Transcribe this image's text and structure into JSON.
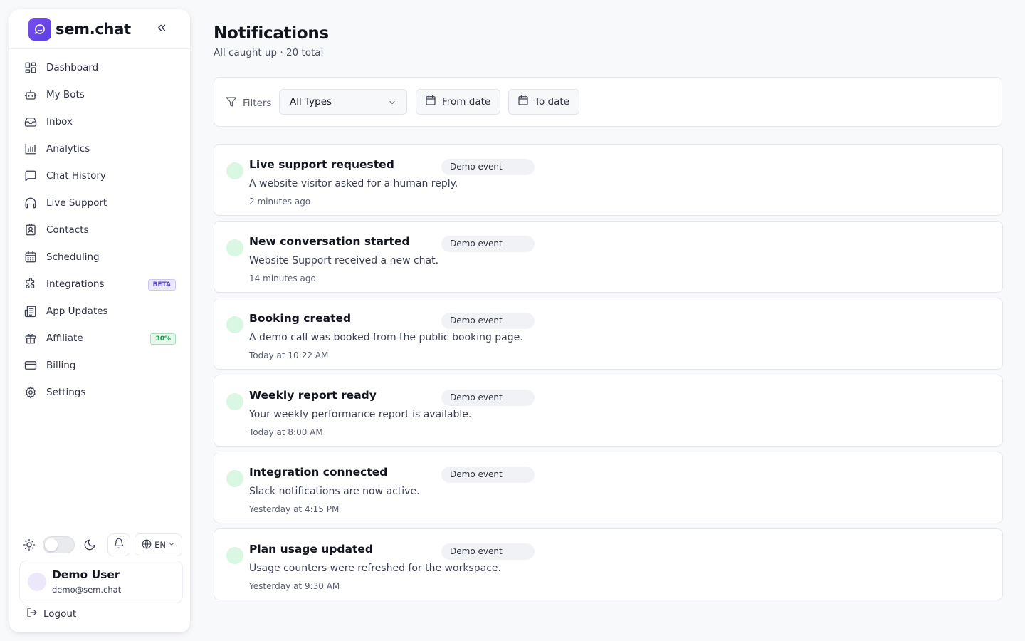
{
  "sidebar": {
    "brand": {
      "name": "sem.chat",
      "logo_icon": "chat-bubble-icon",
      "accent": "#6a45ec"
    },
    "items": [
      {
        "label": "Dashboard",
        "icon": "dashboard-icon"
      },
      {
        "label": "My Bots",
        "icon": "bot-icon"
      },
      {
        "label": "Inbox",
        "icon": "inbox-icon"
      },
      {
        "label": "Analytics",
        "icon": "bar-chart-icon"
      },
      {
        "label": "Chat History",
        "icon": "chat-icon"
      },
      {
        "label": "Live Support",
        "icon": "headphones-icon"
      },
      {
        "label": "Contacts",
        "icon": "contact-card-icon"
      },
      {
        "label": "Scheduling",
        "icon": "calendar-icon"
      },
      {
        "label": "Integrations",
        "icon": "puzzle-icon",
        "badge": "BETA"
      },
      {
        "label": "App Updates",
        "icon": "newspaper-icon"
      },
      {
        "label": "Affiliate",
        "icon": "gift-icon",
        "badge": "30%"
      },
      {
        "label": "Billing",
        "icon": "credit-card-icon"
      },
      {
        "label": "Settings",
        "icon": "gear-icon"
      }
    ],
    "language": "EN",
    "user": {
      "name": "Demo User",
      "email": "demo@sem.chat"
    },
    "logout_label": "Logout"
  },
  "header": {
    "title": "Notifications",
    "subtitle": "All caught up · 20 total"
  },
  "filters": {
    "label": "Filters",
    "type_value": "All Types",
    "from_label": "From date",
    "to_label": "To date"
  },
  "notifications": [
    {
      "title": "Live support requested",
      "badge": "Demo event",
      "body": "A website visitor asked for a human reply.",
      "time": "2 minutes ago"
    },
    {
      "title": "New conversation started",
      "badge": "Demo event",
      "body": "Website Support received a new chat.",
      "time": "14 minutes ago"
    },
    {
      "title": "Booking created",
      "badge": "Demo event",
      "body": "A demo call was booked from the public booking page.",
      "time": "Today at 10:22 AM"
    },
    {
      "title": "Weekly report ready",
      "badge": "Demo event",
      "body": "Your weekly performance report is available.",
      "time": "Today at 8:00 AM"
    },
    {
      "title": "Integration connected",
      "badge": "Demo event",
      "body": "Slack notifications are now active.",
      "time": "Yesterday at 4:15 PM"
    },
    {
      "title": "Plan usage updated",
      "badge": "Demo event",
      "body": "Usage counters were refreshed for the workspace.",
      "time": "Yesterday at 9:30 AM"
    }
  ]
}
